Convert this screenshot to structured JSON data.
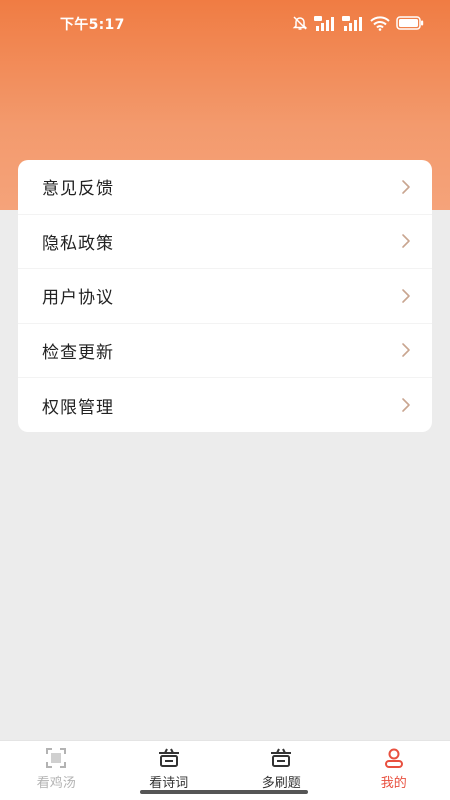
{
  "status_bar": {
    "time": "下午5:17",
    "icons": [
      "mute-bell-icon",
      "hd-signal-icon",
      "hd-signal-icon",
      "wifi-icon",
      "battery-icon"
    ]
  },
  "menu": {
    "items": [
      {
        "label": "意见反馈",
        "icon": "chevron-right-icon"
      },
      {
        "label": "隐私政策",
        "icon": "chevron-right-icon"
      },
      {
        "label": "用户协议",
        "icon": "chevron-right-icon"
      },
      {
        "label": "检查更新",
        "icon": "chevron-right-icon"
      },
      {
        "label": "权限管理",
        "icon": "chevron-right-icon"
      }
    ]
  },
  "tabs": [
    {
      "label": "看鸡汤",
      "icon": "scan-frame-icon",
      "state": "dim"
    },
    {
      "label": "看诗词",
      "icon": "pot-icon",
      "state": "normal"
    },
    {
      "label": "多刷题",
      "icon": "pot-icon",
      "state": "normal"
    },
    {
      "label": "我的",
      "icon": "user-icon",
      "state": "active"
    }
  ],
  "colors": {
    "header_top": "#f07c43",
    "header_bottom": "#f5a37a",
    "accent": "#e8503f",
    "chevron": "#c9a590",
    "background": "#ececec"
  }
}
